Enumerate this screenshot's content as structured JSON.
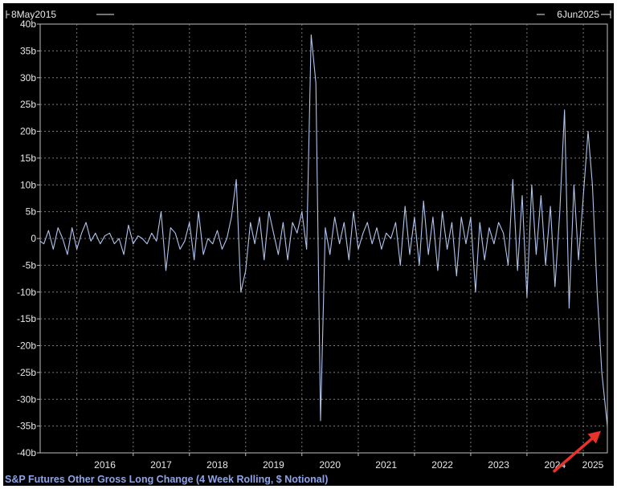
{
  "range": {
    "start": "8May2015",
    "end": "6Jun2025"
  },
  "legend": {
    "label": "S&P Futures Other Gross Long Change (4 Week Rolling, $ Notional)"
  },
  "chart_data": {
    "type": "line",
    "x_axis": {
      "type": "time",
      "range": [
        "2015-05-08",
        "2025-06-06"
      ],
      "ticks": [
        "2016",
        "2017",
        "2018",
        "2019",
        "2020",
        "2021",
        "2022",
        "2023",
        "2024",
        "2025"
      ]
    },
    "y_axis": {
      "ylim": [
        -40,
        40
      ],
      "unit": "b",
      "ticks": [
        "40b",
        "35b",
        "30b",
        "25b",
        "20b",
        "15b",
        "10b",
        "5b",
        "0",
        "-5b",
        "-10b",
        "-15b",
        "-20b",
        "-25b",
        "-30b",
        "-35b",
        "-40b"
      ]
    },
    "grid": true,
    "legend_position": "bottom-left",
    "series": [
      {
        "name": "S&P Futures Other Gross Long Change (4 Week Rolling, $ Notional)",
        "color": "#b0c4ee",
        "points": [
          [
            "2015-05-08",
            -0.5
          ],
          [
            "2015-06-01",
            -1
          ],
          [
            "2015-07-01",
            1.5
          ],
          [
            "2015-08-01",
            -2
          ],
          [
            "2015-09-01",
            2
          ],
          [
            "2015-10-01",
            0
          ],
          [
            "2015-11-01",
            -3
          ],
          [
            "2015-12-01",
            2
          ],
          [
            "2016-01-01",
            -2
          ],
          [
            "2016-02-01",
            1
          ],
          [
            "2016-03-01",
            3
          ],
          [
            "2016-04-01",
            -0.5
          ],
          [
            "2016-05-01",
            1
          ],
          [
            "2016-06-01",
            -1
          ],
          [
            "2016-07-01",
            0.5
          ],
          [
            "2016-08-01",
            1
          ],
          [
            "2016-09-01",
            -1
          ],
          [
            "2016-10-01",
            0
          ],
          [
            "2016-11-01",
            -3
          ],
          [
            "2016-12-01",
            2.5
          ],
          [
            "2017-01-01",
            -1
          ],
          [
            "2017-02-01",
            0.5
          ],
          [
            "2017-03-01",
            0
          ],
          [
            "2017-04-01",
            -1
          ],
          [
            "2017-05-01",
            1
          ],
          [
            "2017-06-01",
            -0.5
          ],
          [
            "2017-07-01",
            5
          ],
          [
            "2017-08-01",
            -6
          ],
          [
            "2017-09-01",
            2
          ],
          [
            "2017-10-01",
            1
          ],
          [
            "2017-11-01",
            -2
          ],
          [
            "2017-12-01",
            -0.5
          ],
          [
            "2018-01-01",
            3
          ],
          [
            "2018-02-01",
            -4
          ],
          [
            "2018-03-01",
            5
          ],
          [
            "2018-04-01",
            -3
          ],
          [
            "2018-05-01",
            0
          ],
          [
            "2018-06-01",
            -1
          ],
          [
            "2018-07-01",
            1.5
          ],
          [
            "2018-08-01",
            -2
          ],
          [
            "2018-09-01",
            0
          ],
          [
            "2018-10-01",
            4
          ],
          [
            "2018-11-01",
            11
          ],
          [
            "2018-12-01",
            -10
          ],
          [
            "2019-01-01",
            -6
          ],
          [
            "2019-02-01",
            3
          ],
          [
            "2019-03-01",
            -1
          ],
          [
            "2019-04-01",
            4
          ],
          [
            "2019-05-01",
            -4
          ],
          [
            "2019-06-01",
            5
          ],
          [
            "2019-07-01",
            1
          ],
          [
            "2019-08-01",
            -3
          ],
          [
            "2019-09-01",
            3
          ],
          [
            "2019-10-01",
            -4
          ],
          [
            "2019-11-01",
            3
          ],
          [
            "2019-12-01",
            1
          ],
          [
            "2020-01-01",
            5
          ],
          [
            "2020-02-01",
            -2
          ],
          [
            "2020-03-01",
            38
          ],
          [
            "2020-04-01",
            29
          ],
          [
            "2020-05-01",
            -34
          ],
          [
            "2020-06-01",
            2
          ],
          [
            "2020-07-01",
            -3
          ],
          [
            "2020-08-01",
            4
          ],
          [
            "2020-09-01",
            -1
          ],
          [
            "2020-10-01",
            3
          ],
          [
            "2020-11-01",
            -4
          ],
          [
            "2020-12-01",
            5
          ],
          [
            "2021-01-01",
            -2
          ],
          [
            "2021-02-01",
            1
          ],
          [
            "2021-03-01",
            3
          ],
          [
            "2021-04-01",
            -1
          ],
          [
            "2021-05-01",
            2
          ],
          [
            "2021-06-01",
            -2
          ],
          [
            "2021-07-01",
            1
          ],
          [
            "2021-08-01",
            0
          ],
          [
            "2021-09-01",
            3
          ],
          [
            "2021-10-01",
            -5
          ],
          [
            "2021-11-01",
            6
          ],
          [
            "2021-12-01",
            -3
          ],
          [
            "2022-01-01",
            4
          ],
          [
            "2022-02-01",
            -5
          ],
          [
            "2022-03-01",
            7
          ],
          [
            "2022-04-01",
            -3
          ],
          [
            "2022-05-01",
            4
          ],
          [
            "2022-06-01",
            -6
          ],
          [
            "2022-07-01",
            5
          ],
          [
            "2022-08-01",
            -2
          ],
          [
            "2022-09-01",
            3
          ],
          [
            "2022-10-01",
            -7
          ],
          [
            "2022-11-01",
            4
          ],
          [
            "2022-12-01",
            -1
          ],
          [
            "2023-01-01",
            4
          ],
          [
            "2023-02-01",
            -10
          ],
          [
            "2023-03-01",
            3
          ],
          [
            "2023-04-01",
            -4
          ],
          [
            "2023-05-01",
            2
          ],
          [
            "2023-06-01",
            -1
          ],
          [
            "2023-07-01",
            3
          ],
          [
            "2023-08-01",
            1
          ],
          [
            "2023-09-01",
            -5
          ],
          [
            "2023-10-01",
            11
          ],
          [
            "2023-11-01",
            -6
          ],
          [
            "2023-12-01",
            8
          ],
          [
            "2024-01-01",
            -11
          ],
          [
            "2024-02-01",
            10
          ],
          [
            "2024-03-01",
            -3
          ],
          [
            "2024-04-01",
            8
          ],
          [
            "2024-05-01",
            -5
          ],
          [
            "2024-06-01",
            6
          ],
          [
            "2024-07-01",
            -9
          ],
          [
            "2024-08-01",
            5
          ],
          [
            "2024-09-01",
            24
          ],
          [
            "2024-10-01",
            -13
          ],
          [
            "2024-11-01",
            10
          ],
          [
            "2024-12-01",
            -4
          ],
          [
            "2025-01-01",
            8
          ],
          [
            "2025-02-01",
            20
          ],
          [
            "2025-03-01",
            10
          ],
          [
            "2025-04-01",
            -10
          ],
          [
            "2025-05-01",
            -25
          ],
          [
            "2025-06-06",
            -35
          ]
        ]
      }
    ],
    "annotations": [
      {
        "type": "arrow",
        "color": "#e8322a",
        "target": [
          "2025-06-06",
          -35
        ]
      }
    ]
  }
}
